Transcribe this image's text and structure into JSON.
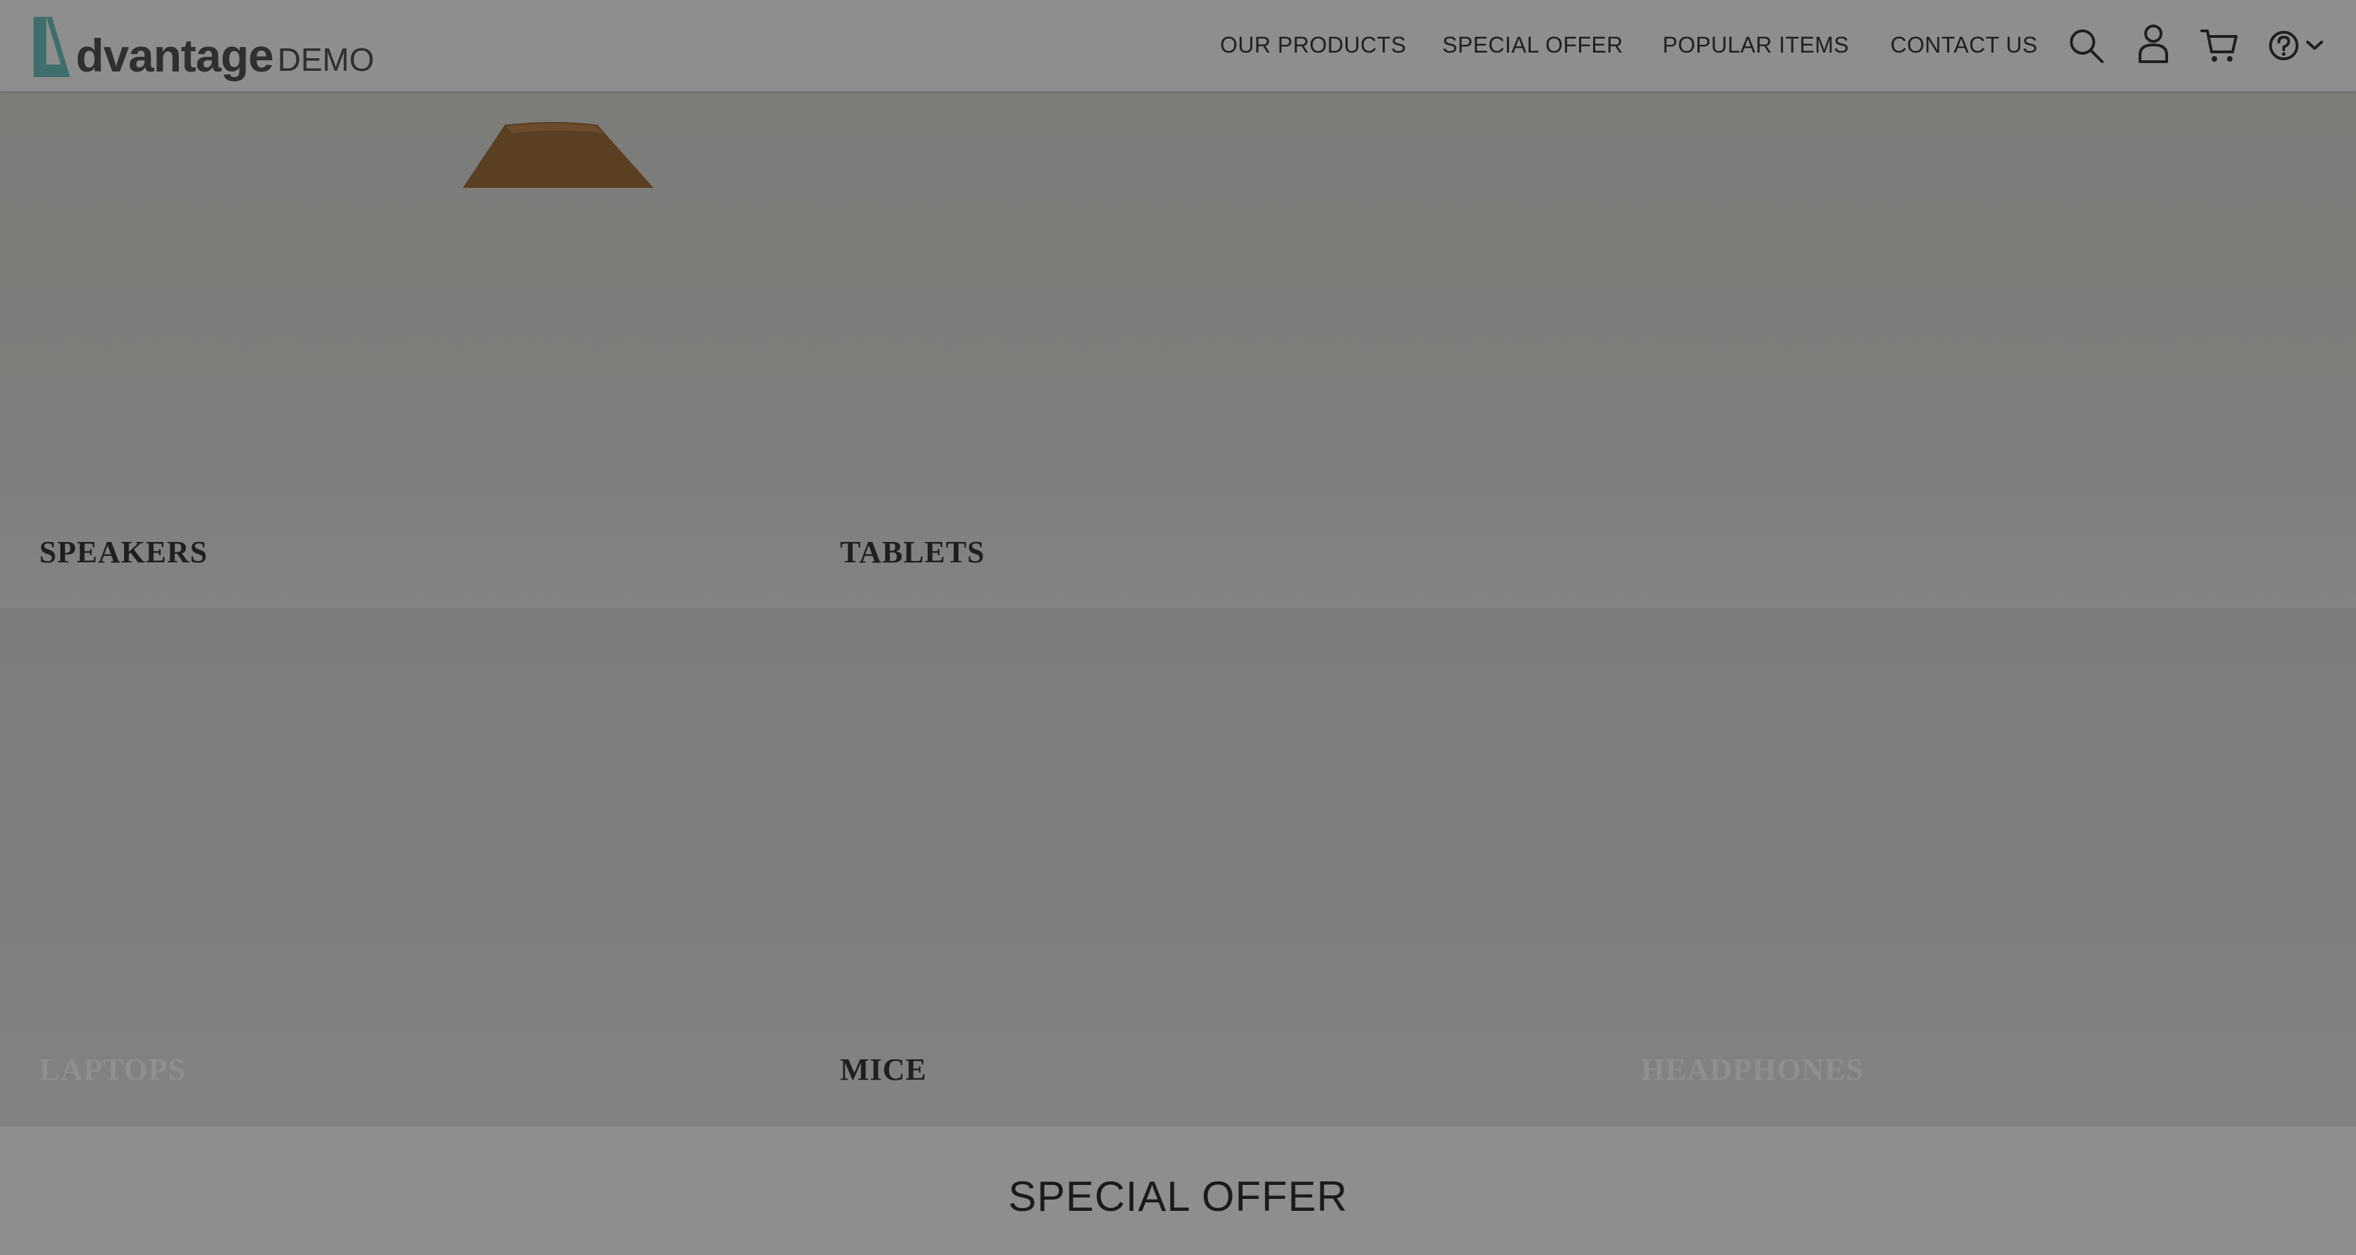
{
  "brand": {
    "name": "dvantage",
    "suffix": "DEMO"
  },
  "nav": {
    "links": [
      "OUR PRODUCTS",
      "SPECIAL OFFER",
      "POPULAR ITEMS",
      "CONTACT US"
    ]
  },
  "icons": [
    "search-icon",
    "user-icon",
    "cart-icon",
    "help-icon",
    "chevron-down-icon"
  ],
  "categories": {
    "speakers": "SPEAKERS",
    "tablets": "TABLETS",
    "laptops": "LAPTOPS",
    "mice": "MICE",
    "headphones": "HEADPHONES"
  },
  "sections": {
    "special_offer_title": "SPECIAL OFFER"
  },
  "colors": {
    "brand_accent": "#3f6f6c",
    "overlay": "#8c8c8c"
  }
}
